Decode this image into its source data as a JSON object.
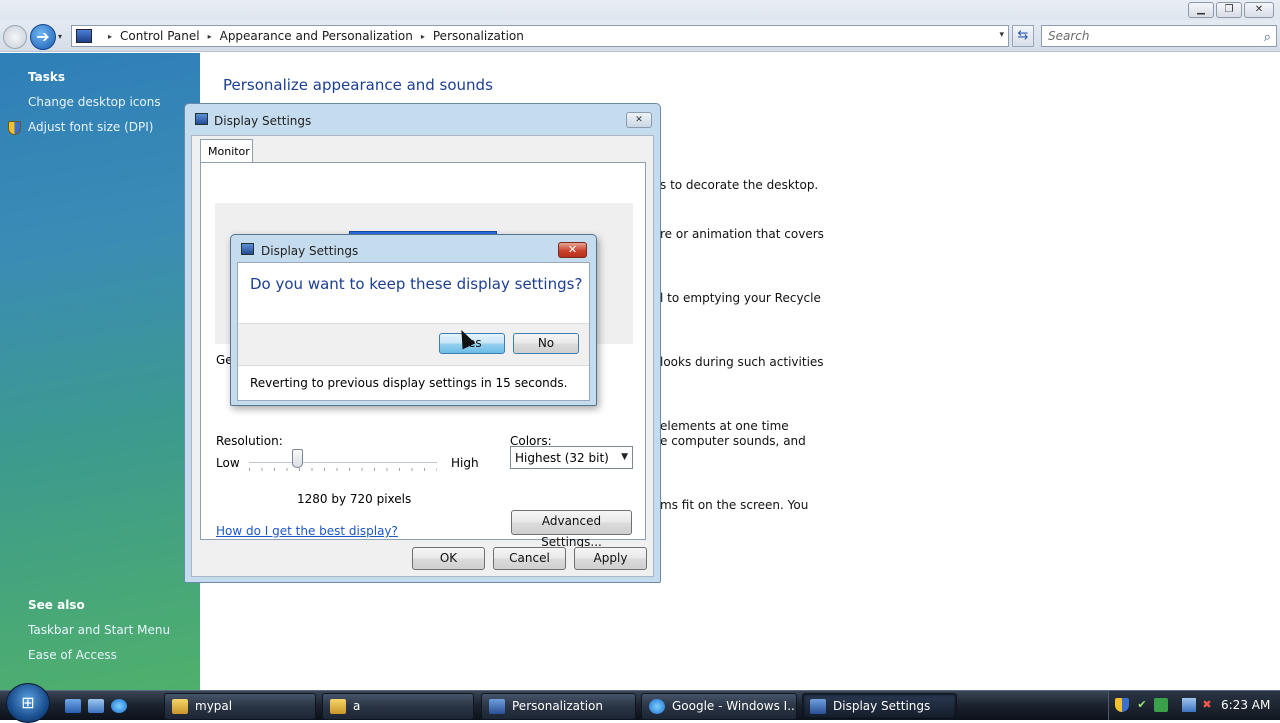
{
  "window": {
    "minimize_glyph": "▁",
    "maximize_glyph": "❐",
    "close_glyph": "✕"
  },
  "nav": {
    "forward_glyph": "➔",
    "dropdown_glyph": "▾",
    "breadcrumb": [
      "Control Panel",
      "Appearance and Personalization",
      "Personalization"
    ],
    "crumb_separator": "▸",
    "address_dropdown_glyph": "▾",
    "refresh_glyph": "⇆",
    "search_placeholder": "Search",
    "search_icon_glyph": "⌕"
  },
  "sidebar": {
    "tasks_heading": "Tasks",
    "tasks": [
      "Change desktop icons",
      "Adjust font size (DPI)"
    ],
    "see_also_heading": "See also",
    "see_also": [
      "Taskbar and Start Menu",
      "Ease of Access"
    ]
  },
  "main": {
    "title": "Personalize appearance and sounds",
    "partial_lines": [
      "s to decorate the desktop.",
      "re or animation that covers",
      "l to emptying your Recycle",
      "looks during such activities",
      "elements at one time",
      "e computer sounds, and",
      "ms fit on the screen. You"
    ]
  },
  "display_dialog": {
    "title": "Display Settings",
    "close_glyph": "✕",
    "tab": "Monitor",
    "general_text": "Ger",
    "resolution_label": "Resolution:",
    "low_label": "Low",
    "high_label": "High",
    "resolution_value": "1280 by 720 pixels",
    "resolution_slider_fraction": 0.26,
    "colors_label": "Colors:",
    "colors_value": "Highest (32 bit)",
    "select_arrow_glyph": "▼",
    "help_link": "How do I get the best display?",
    "advanced_button": "Advanced Settings...",
    "ok_button": "OK",
    "cancel_button": "Cancel",
    "apply_button": "Apply"
  },
  "confirm_dialog": {
    "title": "Display Settings",
    "close_glyph": "✕",
    "question": "Do you want to keep these display settings?",
    "yes_button": "Yes",
    "no_button": "No",
    "footer": "Reverting to previous display settings in 15 seconds."
  },
  "taskbar": {
    "start_glyph": "⊞",
    "buttons": [
      "mypal",
      "a",
      "Personalization",
      "Google - Windows I...",
      "Display Settings"
    ],
    "clock": "6:23 AM"
  },
  "colors": {
    "accent_blue": "#1c3f94",
    "link_blue": "#1e56c6",
    "taskbar_dark": "#1c2430"
  }
}
